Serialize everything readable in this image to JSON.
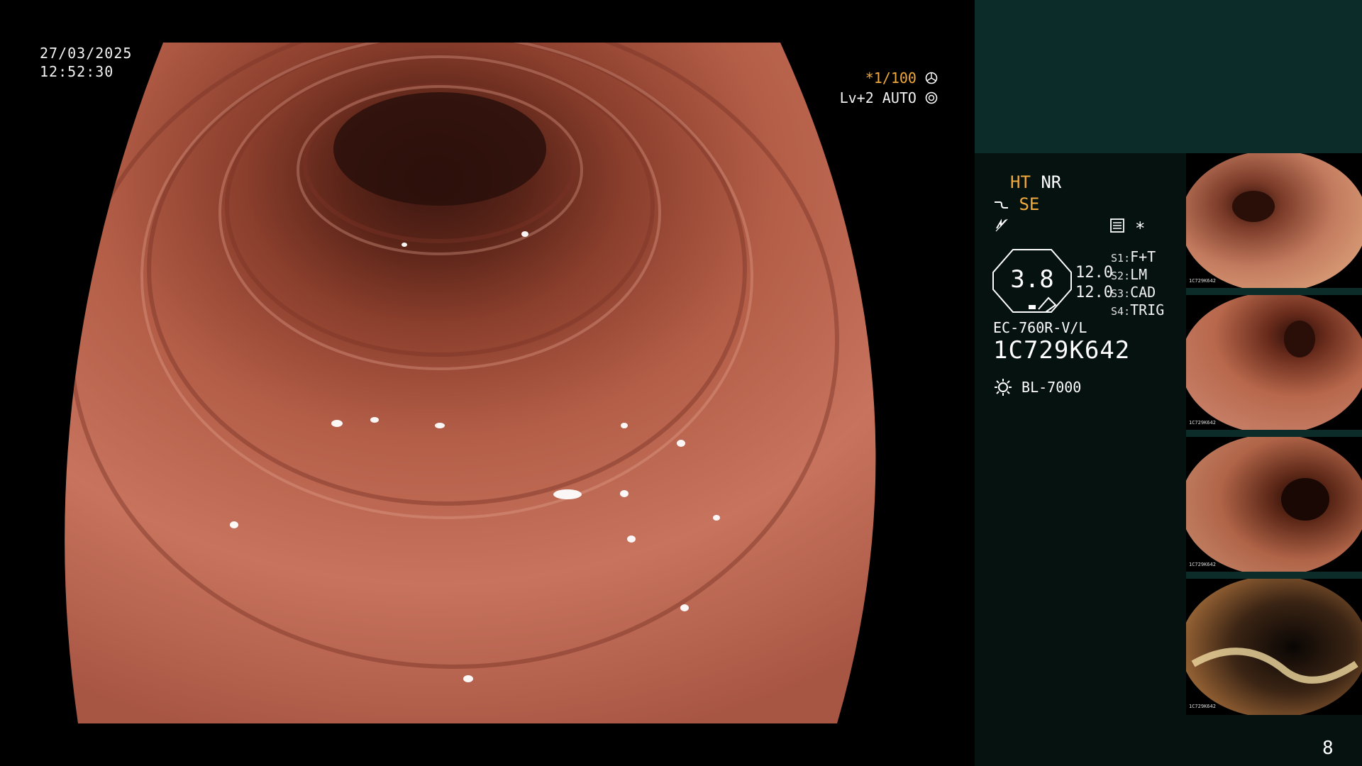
{
  "header": {
    "date": "27/03/2025",
    "time": "12:52:30"
  },
  "overlay": {
    "shutter": "*1/100",
    "shutter_icon": "aperture-icon",
    "level": "Lv+2 AUTO",
    "level_icon": "iris-icon"
  },
  "panel": {
    "mode_ht": "HT",
    "mode_nr": "NR",
    "mode_se": "SE",
    "mode_se_icon": "structure-enhance-icon",
    "flash_icon": "flash-icon",
    "memory_icon": "memory-card-icon",
    "asterisk": "*",
    "zoom_value": "3.8",
    "values": [
      "12.0",
      "12.0"
    ],
    "switches": [
      {
        "key": "S1",
        "value": "F+T"
      },
      {
        "key": "S2",
        "value": "LM"
      },
      {
        "key": "S3",
        "value": "CAD"
      },
      {
        "key": "S4",
        "value": "TRIG"
      }
    ],
    "scope_model": "EC-760R-V/L",
    "serial": "1C729K642",
    "light_source": "BL-7000",
    "light_icon": "light-source-icon"
  },
  "thumbnails": [
    {
      "name": "thumbnail-1",
      "serial": "1C729K642"
    },
    {
      "name": "thumbnail-2",
      "serial": "1C729K642"
    },
    {
      "name": "thumbnail-3",
      "serial": "1C729K642"
    },
    {
      "name": "thumbnail-4",
      "serial": "1C729K642"
    }
  ],
  "page_number": "8",
  "colors": {
    "panel_top": "#0c2c29",
    "panel_bottom": "#061210",
    "accent": "#f0a93a",
    "mucosa": "#c07060"
  }
}
